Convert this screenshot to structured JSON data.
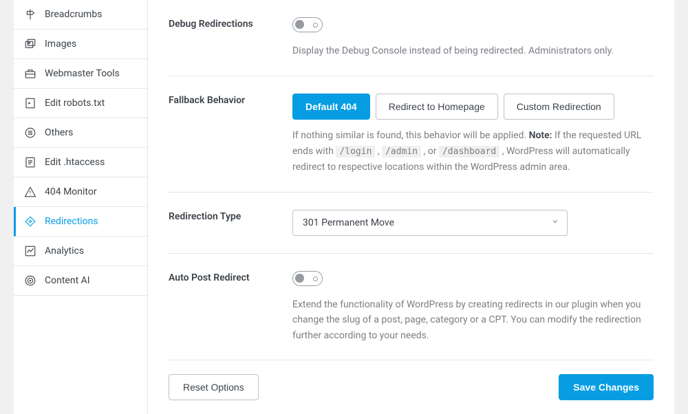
{
  "sidebar": {
    "items": [
      {
        "label": "Breadcrumbs"
      },
      {
        "label": "Images"
      },
      {
        "label": "Webmaster Tools"
      },
      {
        "label": "Edit robots.txt"
      },
      {
        "label": "Others"
      },
      {
        "label": "Edit .htaccess"
      },
      {
        "label": "404 Monitor"
      },
      {
        "label": "Redirections"
      },
      {
        "label": "Analytics"
      },
      {
        "label": "Content AI"
      }
    ]
  },
  "settings": {
    "debug": {
      "label": "Debug Redirections",
      "description": "Display the Debug Console instead of being redirected. Administrators only."
    },
    "fallback": {
      "label": "Fallback Behavior",
      "options": {
        "default404": "Default 404",
        "redirectHome": "Redirect to Homepage",
        "custom": "Custom Redirection"
      },
      "desc_prefix": "If nothing similar is found, this behavior will be applied. ",
      "note_label": "Note:",
      "desc_mid": " If the requested URL ends with ",
      "code1": "/login",
      "sep1": " , ",
      "code2": "/admin",
      "sep2": " , or ",
      "code3": "/dashboard",
      "desc_suffix": " , WordPress will automatically redirect to respective locations within the WordPress admin area."
    },
    "redirectionType": {
      "label": "Redirection Type",
      "selected": "301 Permanent Move"
    },
    "autoPost": {
      "label": "Auto Post Redirect",
      "description": "Extend the functionality of WordPress by creating redirects in our plugin when you change the slug of a post, page, category or a CPT. You can modify the redirection further according to your needs."
    }
  },
  "footer": {
    "reset": "Reset Options",
    "save": "Save Changes"
  }
}
